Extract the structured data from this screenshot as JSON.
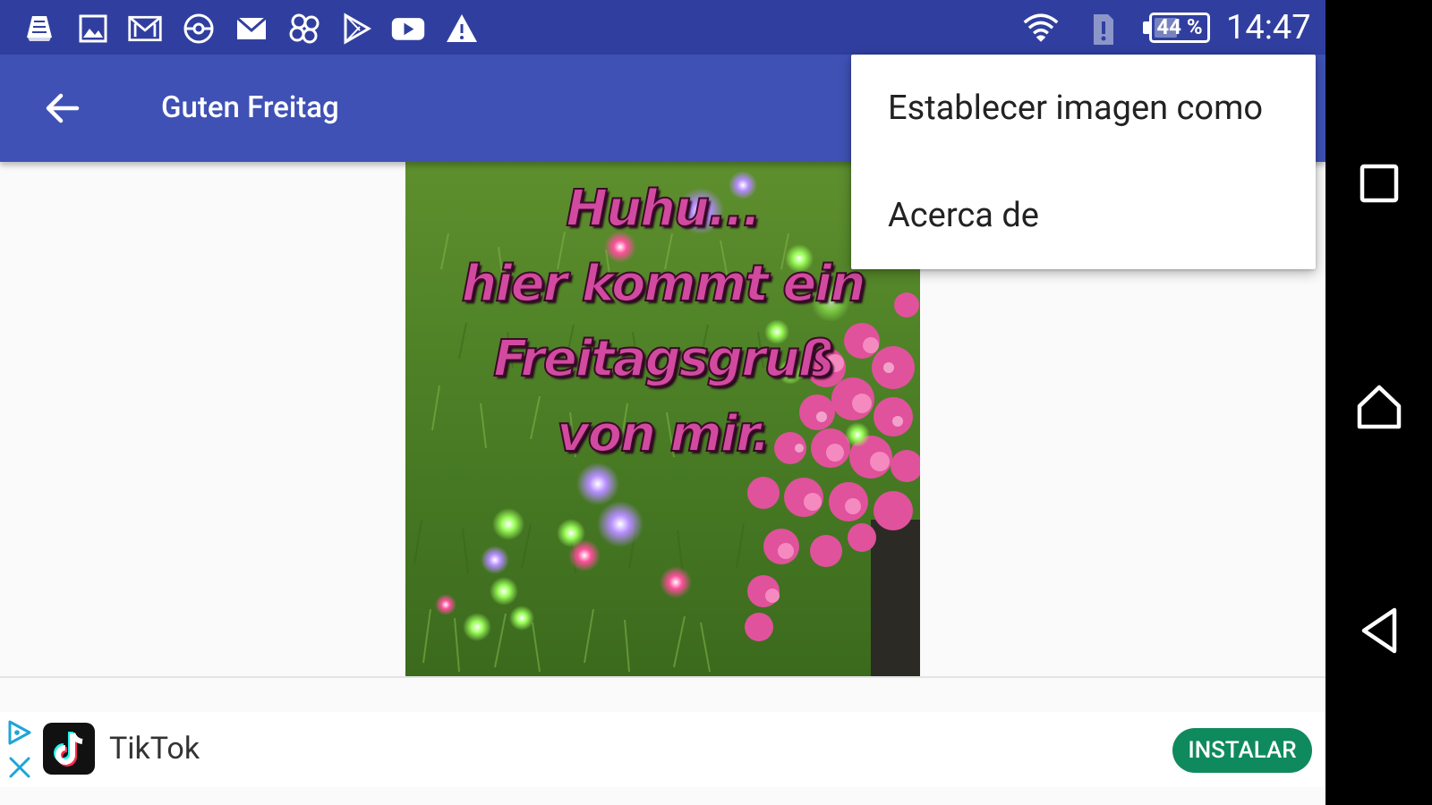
{
  "status_bar": {
    "notification_icons": [
      "docs-icon",
      "gallery-icon",
      "mail-icon",
      "pokeball-icon",
      "gmail-icon",
      "pinwheel-icon",
      "play-store-icon",
      "youtube-icon",
      "warning-icon"
    ],
    "battery_percent": 44,
    "battery_label": "44 %",
    "time": "14:47"
  },
  "app_bar": {
    "title": "Guten Freitag",
    "color": "#3f51b5",
    "status_color": "#303f9f"
  },
  "image_card": {
    "lines": [
      "Huhu...",
      "hier kommt ein",
      "Freitagsgruß",
      "von mir."
    ]
  },
  "overflow_menu": {
    "items": [
      {
        "label": "Establecer imagen como"
      },
      {
        "label": "Acerca de"
      }
    ]
  },
  "ad": {
    "app_name": "TikTok",
    "install_label": "INSTALAR",
    "install_color": "#0f8a5f"
  },
  "nav_bar": {
    "buttons": [
      "recents-icon",
      "home-icon",
      "back-triangle-icon"
    ]
  }
}
